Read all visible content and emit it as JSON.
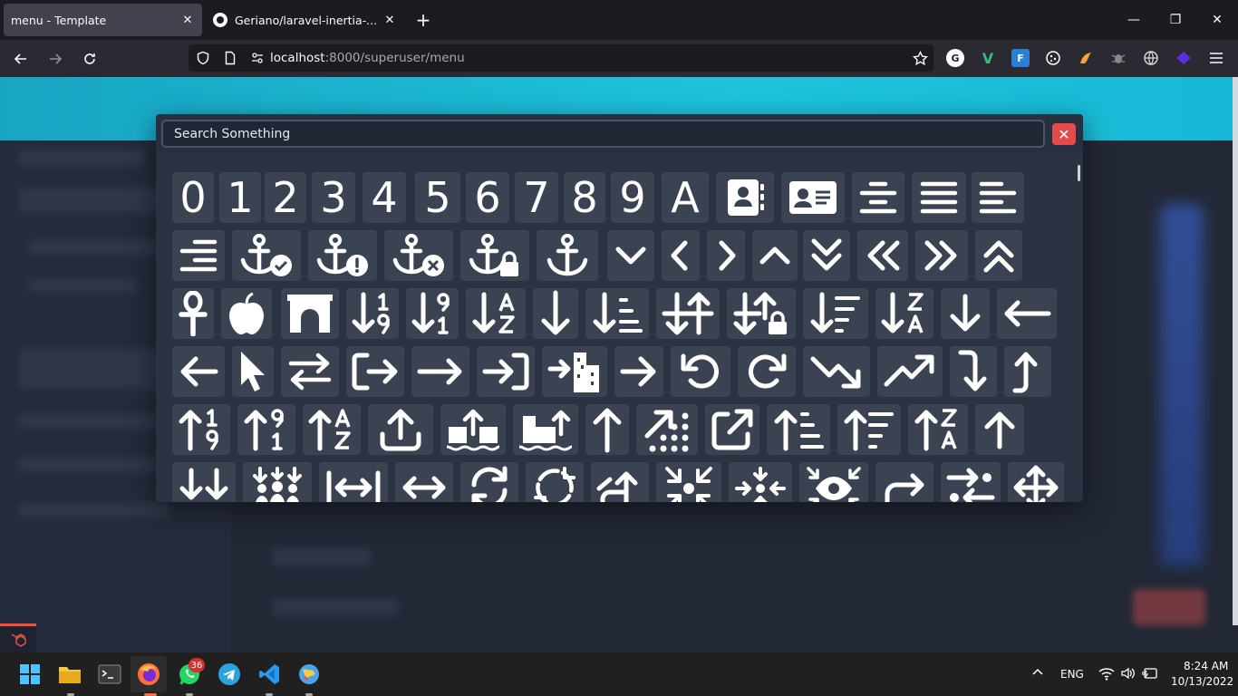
{
  "browser": {
    "tabs": [
      {
        "label": "menu - Template",
        "active": true
      },
      {
        "label": "Geriano/laravel-inertia-vite-tem",
        "active": false
      }
    ],
    "new_tab": "+",
    "url_host": "localhost",
    "url_path": ":8000/superuser/menu",
    "window_controls": {
      "minimize": "—",
      "restore": "❐",
      "close": "✕"
    }
  },
  "extensions": [
    "G",
    "V",
    "F",
    "cookie",
    "flame",
    "bug",
    "globe",
    "gem"
  ],
  "modal": {
    "search_placeholder": "Search Something",
    "close_label": "✕"
  },
  "icons": {
    "row1": [
      "0",
      "1",
      "2",
      "3",
      "4",
      "5",
      "6",
      "7",
      "8",
      "9",
      "A",
      "address-book-icon",
      "address-card-icon",
      "align-center-icon",
      "align-justify-icon",
      "align-left-icon"
    ],
    "row2": [
      "align-right-icon",
      "anchor-circle-check-icon",
      "anchor-circle-exclamation-icon",
      "anchor-circle-xmark-icon",
      "anchor-lock-icon",
      "anchor-icon",
      "angle-down-icon",
      "angle-left-icon",
      "angle-right-icon",
      "angle-up-icon",
      "angles-down-icon",
      "angles-left-icon",
      "angles-right-icon",
      "angles-up-icon"
    ],
    "row3": [
      "ankh-icon",
      "apple-whole-icon",
      "archway-icon",
      "arrow-down-1-9-icon",
      "arrow-down-9-1-icon",
      "arrow-down-a-z-icon",
      "arrow-down-long-icon",
      "arrow-down-short-wide-icon",
      "arrow-down-up-across-line-icon",
      "arrow-down-up-lock-icon",
      "arrow-down-wide-short-icon",
      "arrow-down-z-a-icon",
      "arrow-down-icon",
      "arrow-left-long-icon"
    ],
    "row4": [
      "arrow-left-icon",
      "arrow-pointer-icon",
      "arrow-right-arrow-left-icon",
      "arrow-right-from-bracket-icon",
      "arrow-right-long-icon",
      "arrow-right-to-bracket-icon",
      "arrow-right-to-city-icon",
      "arrow-right-icon",
      "arrow-rotate-left-icon",
      "arrow-rotate-right-icon",
      "arrow-trend-down-icon",
      "arrow-trend-up-icon",
      "arrow-turn-down-icon",
      "arrow-turn-up-icon"
    ],
    "row5": [
      "arrow-up-1-9-icon",
      "arrow-up-9-1-icon",
      "arrow-up-a-z-icon",
      "arrow-up-from-bracket-icon",
      "arrow-up-from-ground-water-icon",
      "arrow-up-from-water-pump-icon",
      "arrow-up-long-icon",
      "arrow-up-right-dots-icon",
      "arrow-up-right-from-square-icon",
      "arrow-up-short-wide-icon",
      "arrow-up-wide-short-icon",
      "arrow-up-z-a-icon",
      "arrow-up-icon"
    ],
    "row6": [
      "arrows-down-to-line-icon",
      "arrows-down-to-people-icon",
      "arrows-left-right-to-line-icon",
      "arrows-left-right-icon",
      "arrows-rotate-icon",
      "arrows-spin-icon",
      "arrows-split-up-and-left-icon",
      "arrows-to-circle-icon",
      "arrows-to-dot-icon",
      "arrows-to-eye-icon",
      "arrows-turn-right-icon",
      "arrows-turn-to-dots-icon",
      "arrows-up-down-left-right-icon"
    ]
  },
  "taskbar": {
    "whatsapp_badge": "36",
    "language": "ENG",
    "time": "8:24 AM",
    "date": "10/13/2022"
  }
}
